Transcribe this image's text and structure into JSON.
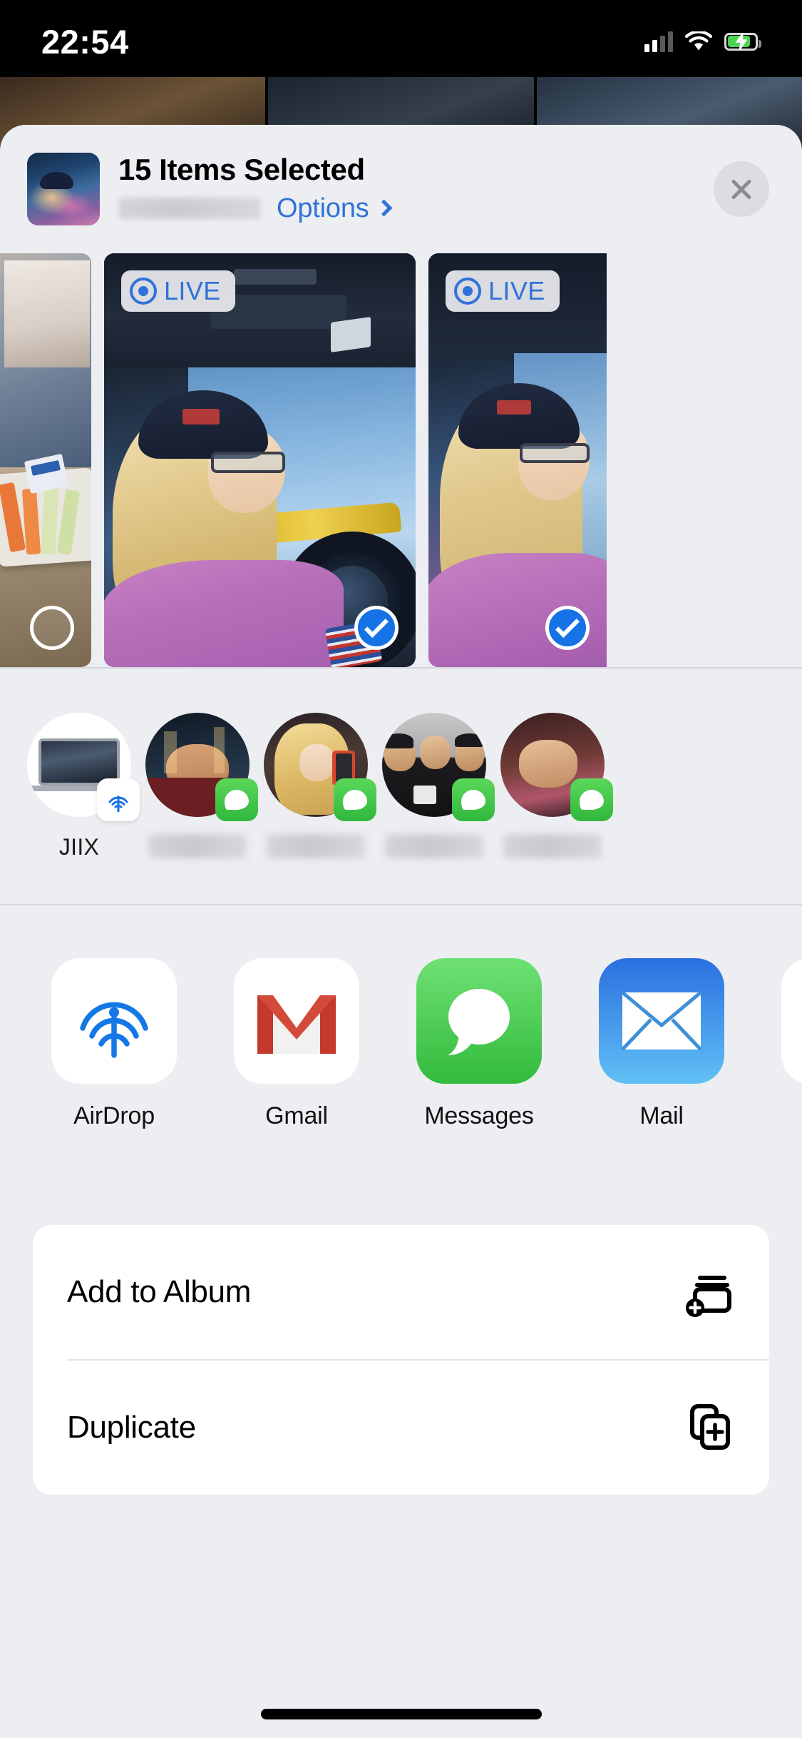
{
  "status_bar": {
    "time": "22:54",
    "cellular_icon": "signal-bars-icon",
    "wifi_icon": "wifi-icon",
    "battery_icon": "battery-charging-icon",
    "battery_charging": true,
    "battery_color": "#4cd352"
  },
  "header": {
    "thumbnail_name": "selection-thumbnail",
    "title": "15 Items Selected",
    "subtitle_redacted": true,
    "options_label": "Options",
    "options_chevron": "chevron-right-icon",
    "options_color": "#3072d8",
    "close_label": "Close",
    "close_icon": "close-icon"
  },
  "photo_strip": {
    "live_badge_label": "LIVE",
    "photos": [
      {
        "name": "photo-food-tray",
        "live": false,
        "selected": false
      },
      {
        "name": "photo-driver-live",
        "live": true,
        "selected": true
      },
      {
        "name": "photo-driver-live-2",
        "live": true,
        "selected": true
      }
    ]
  },
  "contacts": [
    {
      "name": "JIIX",
      "type": "airdrop-device",
      "badge": "airdrop-icon",
      "redacted": false
    },
    {
      "name": "",
      "type": "contact",
      "badge": "messages-icon",
      "redacted": true
    },
    {
      "name": "",
      "type": "contact",
      "badge": "messages-icon",
      "redacted": true
    },
    {
      "name": "",
      "type": "contact",
      "badge": "messages-icon",
      "redacted": true
    },
    {
      "name": "",
      "type": "contact",
      "badge": "messages-icon",
      "redacted": true
    }
  ],
  "apps": [
    {
      "label": "AirDrop",
      "icon": "airdrop-icon"
    },
    {
      "label": "Gmail",
      "icon": "gmail-icon"
    },
    {
      "label": "Messages",
      "icon": "messages-icon"
    },
    {
      "label": "Mail",
      "icon": "mail-icon"
    },
    {
      "label": "",
      "icon": "google-icon"
    }
  ],
  "actions": [
    {
      "label": "Add to Album",
      "icon": "add-to-album-icon"
    },
    {
      "label": "Duplicate",
      "icon": "duplicate-icon"
    }
  ],
  "colors": {
    "accent_blue": "#3072d8",
    "selected_blue": "#1673e6",
    "messages_green": "#32bb3c",
    "sheet_bg": "#edeef2",
    "card_bg": "#ffffff"
  }
}
